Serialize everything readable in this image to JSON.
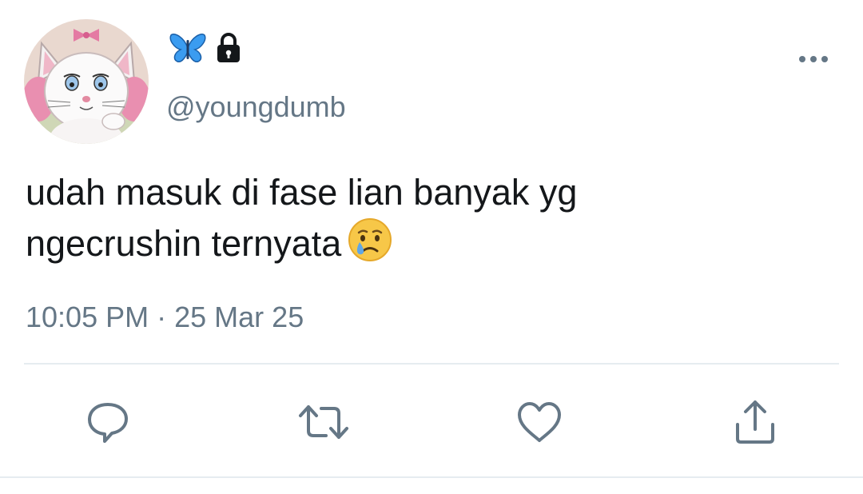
{
  "author": {
    "display_name_emojis": [
      "blue-butterfly",
      "lock"
    ],
    "handle": "@youngdumb"
  },
  "tweet": {
    "line1": "udah masuk di fase lian banyak yg",
    "line2": "ngecrushin ternyata",
    "emoji": "crying-face",
    "time": "10:05 PM",
    "separator": "·",
    "date": "25 Mar 25"
  },
  "actions": [
    "reply-icon",
    "retweet-icon",
    "like-icon",
    "share-icon"
  ],
  "colors": {
    "text": "#14171a",
    "secondary": "#657786",
    "divider": "#e6ecf0",
    "butterfly": "#3b9cf0"
  }
}
